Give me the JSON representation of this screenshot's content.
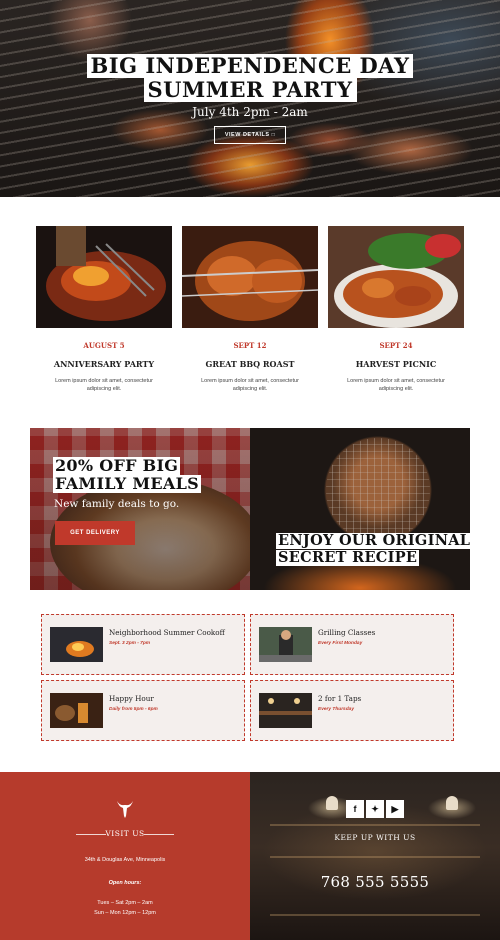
{
  "hero": {
    "title_line1": "BIG INDEPENDENCE DAY",
    "title_line2": "SUMMER PARTY",
    "subtitle": "July 4th 2pm - 2am",
    "cta": "VIEW DETAILS",
    "cta_icon": "lock-icon"
  },
  "events": [
    {
      "date": "AUGUST 5",
      "name": "ANNIVERSARY PARTY",
      "desc": "Lorem ipsum dolor sit amet, consectetur adipiscing elit."
    },
    {
      "date": "SEPT 12",
      "name": "GREAT BBQ ROAST",
      "desc": "Lorem ipsum dolor sit amet, consectetur adipiscing elit."
    },
    {
      "date": "SEPT 24",
      "name": "HARVEST PICNIC",
      "desc": "Lorem ipsum dolor sit amet, consectetur adipiscing elit."
    }
  ],
  "promo": {
    "left_line1": "20% OFF BIG",
    "left_line2": "FAMILY MEALS",
    "left_sub": "New family deals to go.",
    "left_button": "GET DELIVERY",
    "right_line1": "ENJOY OUR ORIGINAL",
    "right_line2": "SECRET RECIPE"
  },
  "cards": [
    {
      "title": "Neighborhood Summer Cookoff",
      "when": "Sept. 3 2pm - 7pm"
    },
    {
      "title": "Grilling Classes",
      "when": "Every First Monday"
    },
    {
      "title": "Happy Hour",
      "when": "Daily from 5pm - 6pm"
    },
    {
      "title": "2 for 1 Taps",
      "when": "Every Thursday"
    }
  ],
  "footer": {
    "visit_heading": "VISIT US",
    "address": "34th & Douglas Ave, Minneapolis",
    "hours_heading": "Open hours:",
    "hours_line1": "Tues – Sat  2pm – 2am",
    "hours_line2": "Sun – Mon 12pm – 12pm",
    "keep_heading": "KEEP UP WITH US",
    "phone": "768 555 5555",
    "social_icons": [
      "facebook-icon",
      "twitter-icon",
      "youtube-icon"
    ]
  },
  "colors": {
    "accent": "#c0392b",
    "footer_red": "#b63b2c",
    "card_bg": "#f4efed"
  }
}
